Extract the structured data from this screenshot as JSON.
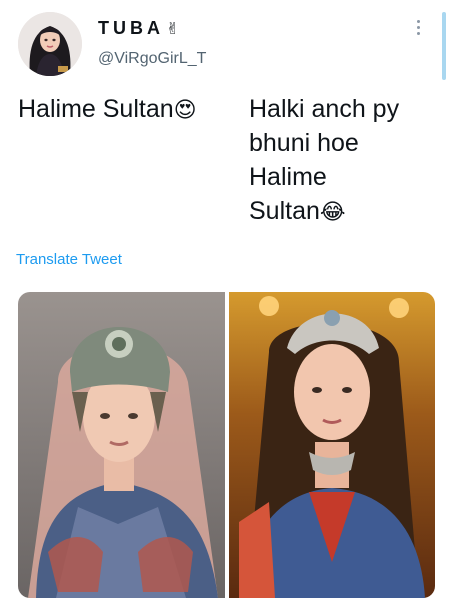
{
  "tweet": {
    "display_name": "TUBA",
    "name_emoji": "✌",
    "handle": "@ViRgoGirL_T",
    "text_left": "Halime Sultan",
    "text_left_emoji": "😍",
    "text_right_lines": [
      "Halki anch py",
      "bhuni hoe",
      "Halime",
      "Sultan"
    ],
    "text_right_emoji": "😂",
    "translate_label": "Translate Tweet"
  },
  "media": {
    "images": [
      "photo-halime-original",
      "photo-halime-lookalike"
    ]
  },
  "colors": {
    "link": "#1d9bf0",
    "handle": "#536471",
    "text": "#0f1419",
    "scroll_indicator": "#a9d7f0"
  }
}
